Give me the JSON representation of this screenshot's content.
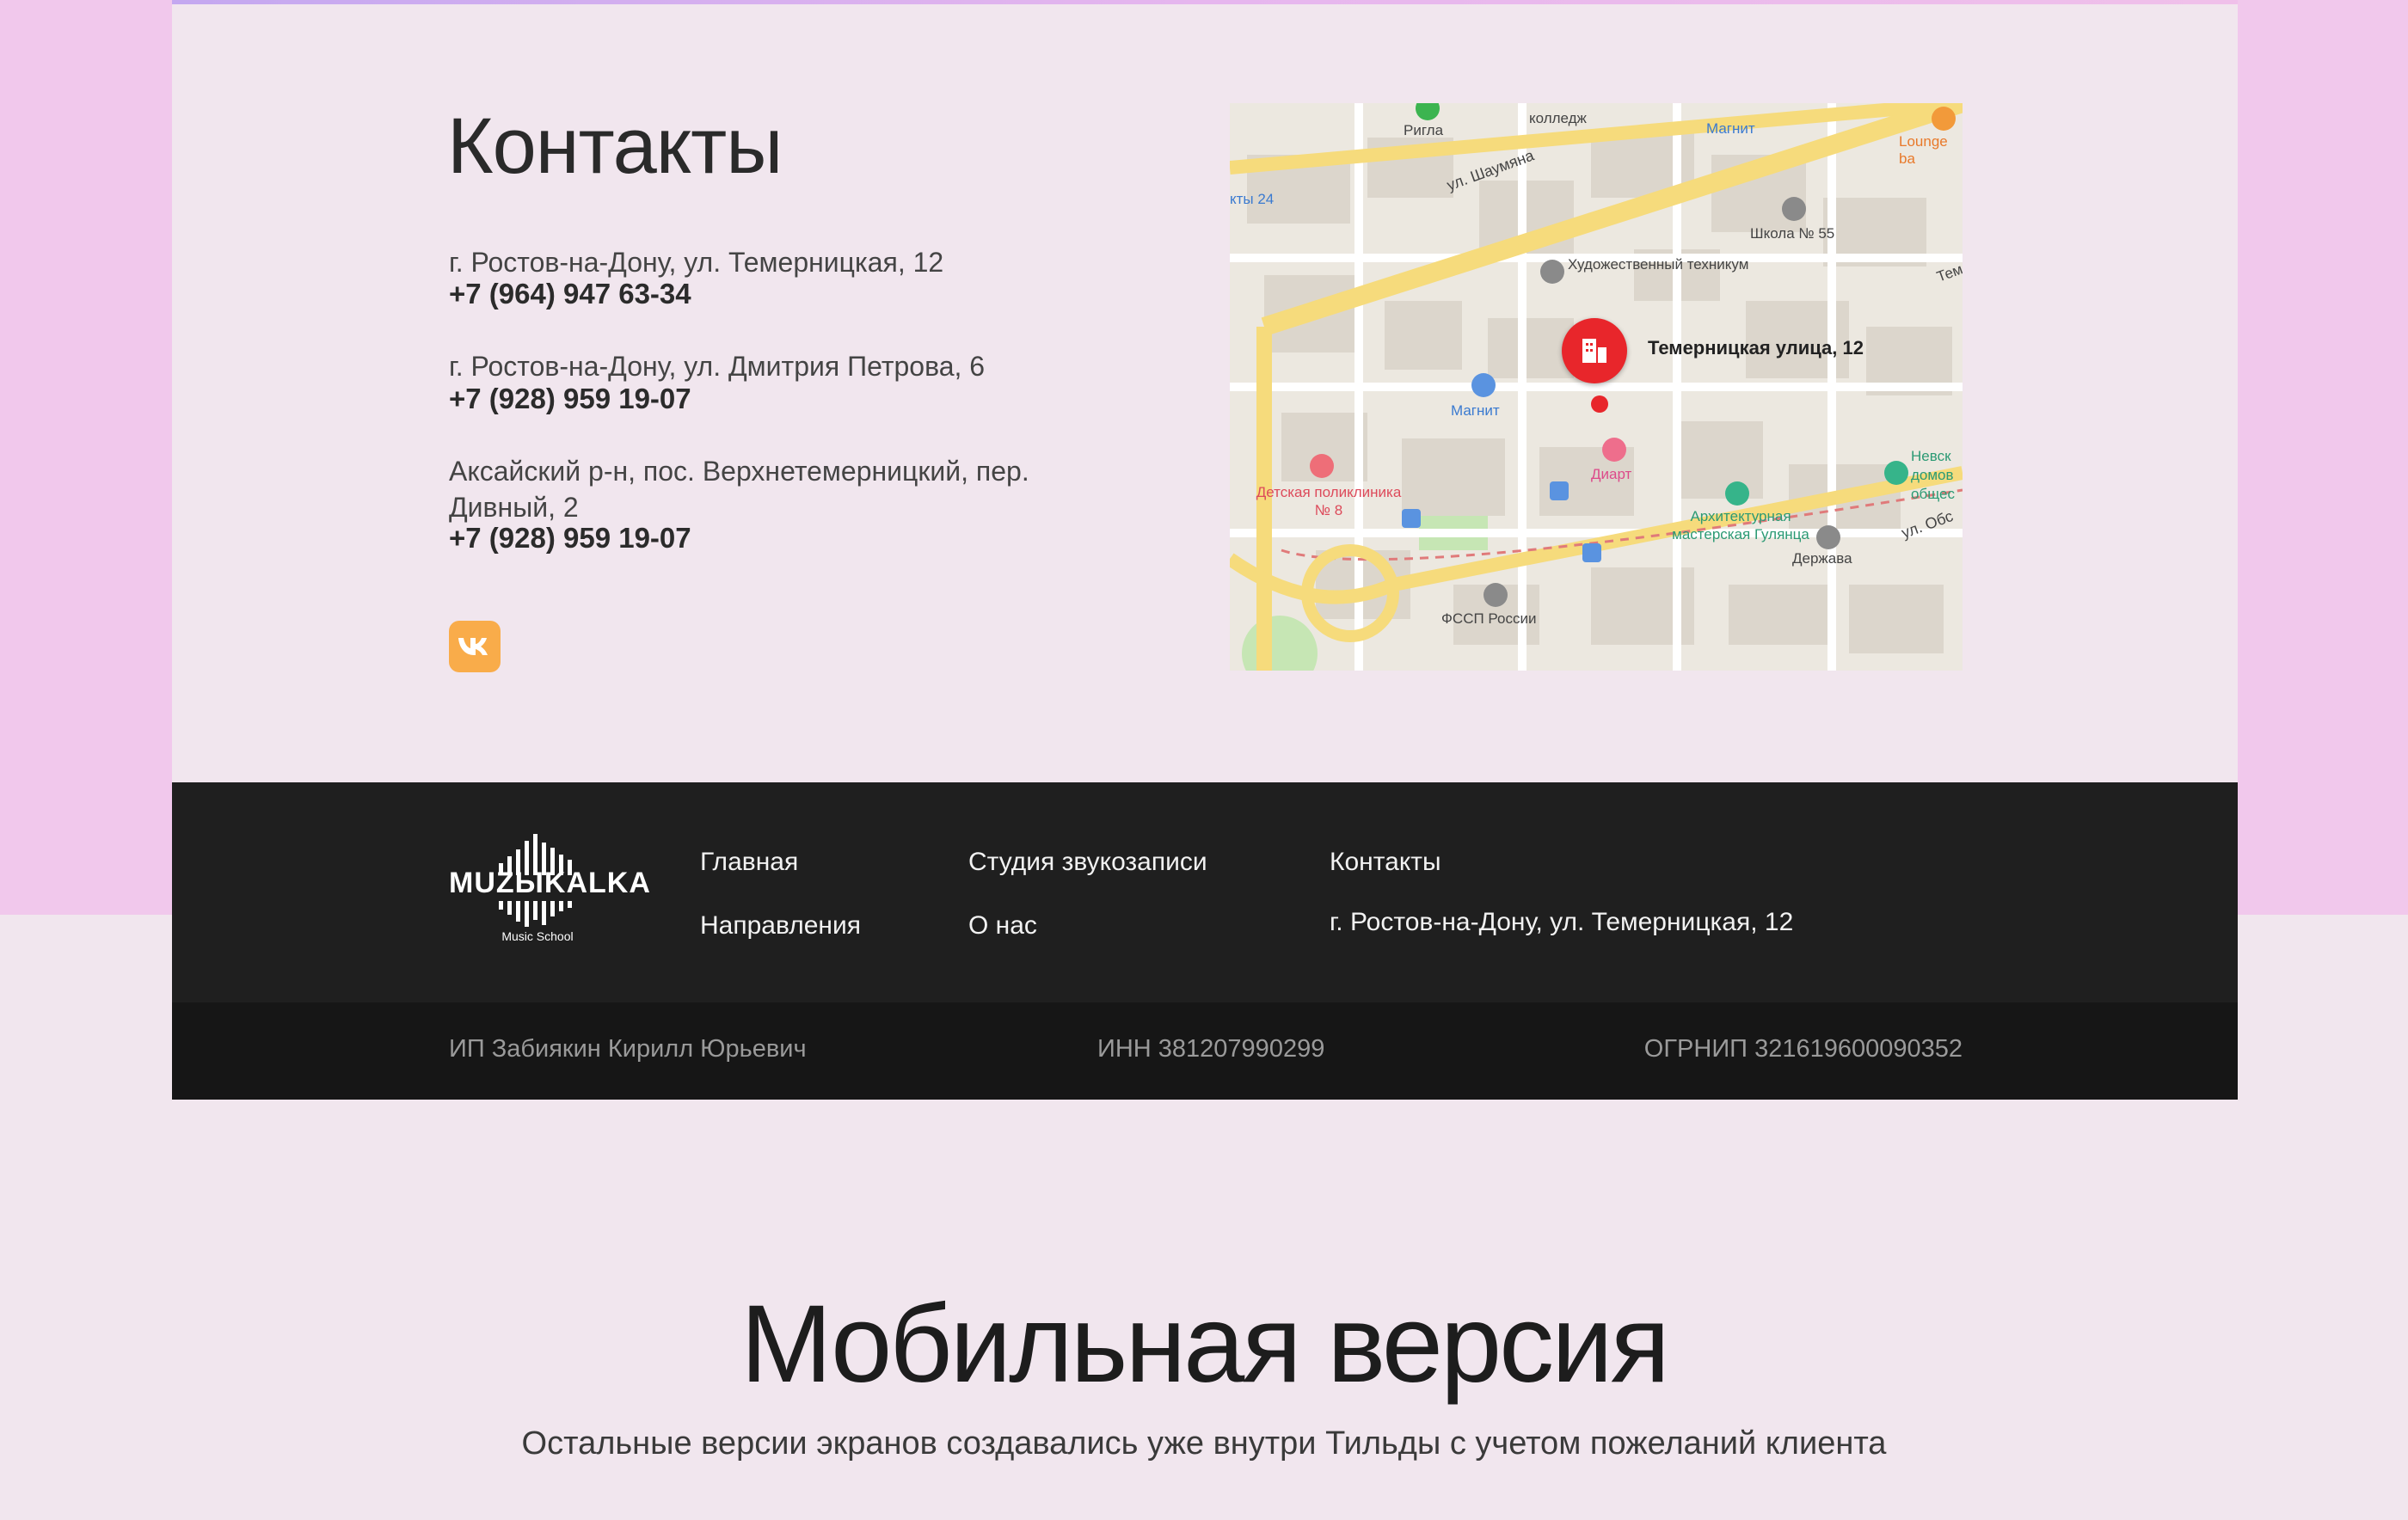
{
  "contacts": {
    "title": "Контакты",
    "locations": [
      {
        "address": "г. Ростов-на-Дону, ул. Темерницкая, 12",
        "phone": "+7 (964) 947 63-34"
      },
      {
        "address": "г. Ростов-на-Дону, ул. Дмитрия Петрова, 6",
        "phone": "+7  (928) 959 19-07"
      },
      {
        "address": "Аксайский р-н, пос. Верхнетемерницкий, пер. Дивный, 2",
        "phone": "+7  (928) 959 19-07"
      }
    ],
    "social_icon": "vk-icon"
  },
  "map": {
    "marker_label": "Темерницкая улица, 12",
    "labels": {
      "rigla": "Ригла",
      "magnit_top": "Магнит",
      "lounge": "Lounge ba",
      "shaumyana": "ул. Шаумяна",
      "school": "Школа № 55",
      "art_school": "Художественный техникум",
      "magnit_mid": "Магнит",
      "polyclinic": "Детская поликлиника № 8",
      "diart": "Диарт",
      "architect": "Архитектурная мастерская Гулянца",
      "derzhava": "Держава",
      "nevsk": "Невск домов общес",
      "fssp": "ФССП России",
      "college": "колледж",
      "kvity": "кты 24",
      "obs": "ул. Обс",
      "tem": "Тем"
    }
  },
  "footer": {
    "nav": {
      "home": "Главная",
      "directions": "Направления",
      "studio": "Студия звукозаписи",
      "about": "О нас",
      "contacts": "Контакты",
      "address": "г. Ростов-на-Дону, ул. Темерницкая, 12"
    },
    "logo": {
      "name": "MUZЫKALKA",
      "tagline": "Music School"
    },
    "legal": {
      "owner": "ИП Забиякин Кирилл Юрьевич",
      "inn": "ИНН 381207990299",
      "ogrnip": "ОГРНИП 321619600090352"
    }
  },
  "mobile": {
    "title": "Мобильная версия",
    "subtitle": "Остальные версии экранов создавались уже внутри Тильды с учетом пожеланий клиента"
  },
  "colors": {
    "accent_vk": "#f9ac4a",
    "marker": "#e8262b",
    "footer": "#1f1f1f",
    "page_bg": "#f1e6ee",
    "outer_pink": "#f1c8ec"
  }
}
